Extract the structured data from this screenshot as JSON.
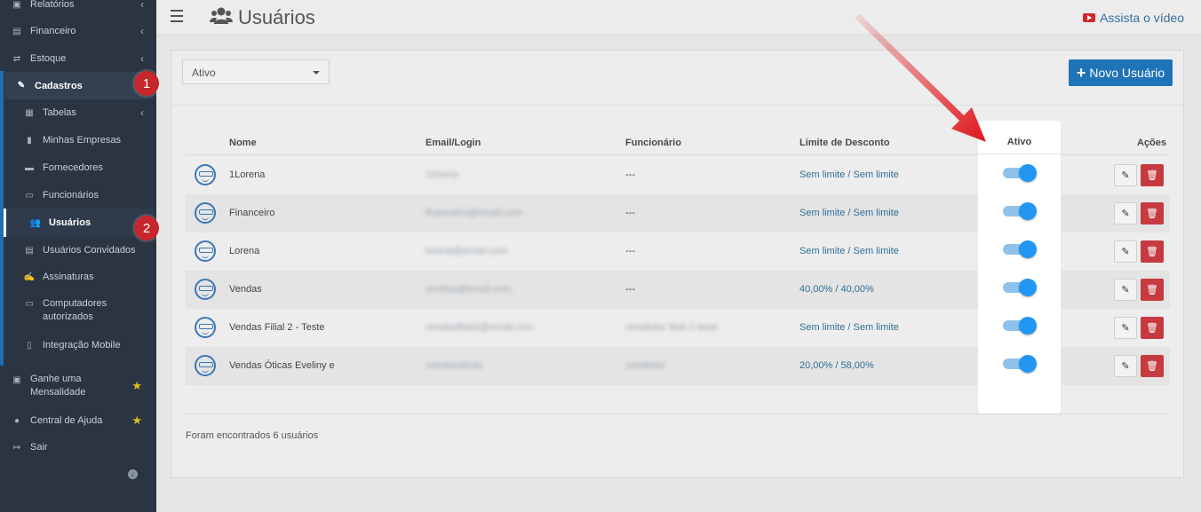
{
  "sidebar": {
    "items": [
      {
        "label": "Relatórios",
        "icon": "report-icon"
      },
      {
        "label": "Financeiro",
        "icon": "money-icon"
      },
      {
        "label": "Estoque",
        "icon": "exchange-icon"
      },
      {
        "label": "Cadastros",
        "icon": "edit-icon"
      },
      {
        "label": "Tabelas",
        "icon": "table-icon"
      },
      {
        "label": "Minhas Empresas",
        "icon": "building-icon"
      },
      {
        "label": "Fornecedores",
        "icon": "truck-icon"
      },
      {
        "label": "Funcionários",
        "icon": "folder-icon"
      },
      {
        "label": "Usuários",
        "icon": "users-icon"
      },
      {
        "label": "Usuários Convidados",
        "icon": "id-card-icon"
      },
      {
        "label": "Assinaturas",
        "icon": "signature-icon"
      },
      {
        "label": "Computadores autorizados",
        "icon": "monitor-icon"
      },
      {
        "label": "Integração Mobile",
        "icon": "mobile-icon"
      },
      {
        "label": "Ganhe uma Mensalidade",
        "icon": "gift-icon"
      },
      {
        "label": "Central de Ajuda",
        "icon": "help-icon"
      },
      {
        "label": "Sair",
        "icon": "logout-icon"
      }
    ],
    "badges": {
      "first": "1",
      "second": "2"
    }
  },
  "header": {
    "title": "Usuários",
    "video_link": "Assista o vídeo"
  },
  "filter": {
    "selected": "Ativo"
  },
  "new_user_button": "Novo Usuário",
  "table": {
    "columns": [
      "Nome",
      "Email/Login",
      "Funcionário",
      "Limite de Desconto",
      "Ativo",
      "Ações"
    ],
    "rows": [
      {
        "name": "1Lorena",
        "email": "1lorena",
        "funcionario": "---",
        "limite": "Sem limite / Sem limite",
        "ativo": true
      },
      {
        "name": "Financeiro",
        "email": "financeiro@email.com",
        "funcionario": "---",
        "limite": "Sem limite / Sem limite",
        "ativo": true
      },
      {
        "name": "Lorena",
        "email": "lorena@email.com",
        "funcionario": "---",
        "limite": "Sem limite / Sem limite",
        "ativo": true
      },
      {
        "name": "Vendas",
        "email": "vendas@email.com",
        "funcionario": "---",
        "limite": "40,00% / 40,00%",
        "ativo": true
      },
      {
        "name": "Vendas Filial 2 - Teste",
        "email": "vendasfilial2@email.com",
        "funcionario": "vendedor filial 2 teste",
        "limite": "Sem limite / Sem limite",
        "ativo": true
      },
      {
        "name": "Vendas Óticas Eveliny e",
        "email": "vendasoticas",
        "funcionario": "vendedor",
        "limite": "20,00% / 58,00%",
        "ativo": true
      }
    ]
  },
  "footer_text": "Foram encontrados 6 usuários",
  "colors": {
    "sidebar": "#2b3542",
    "accent": "#1f73b7",
    "toggle": "#2196f3",
    "danger": "#c73a40",
    "badge": "#c6262c",
    "arrow": "#e0161c"
  }
}
